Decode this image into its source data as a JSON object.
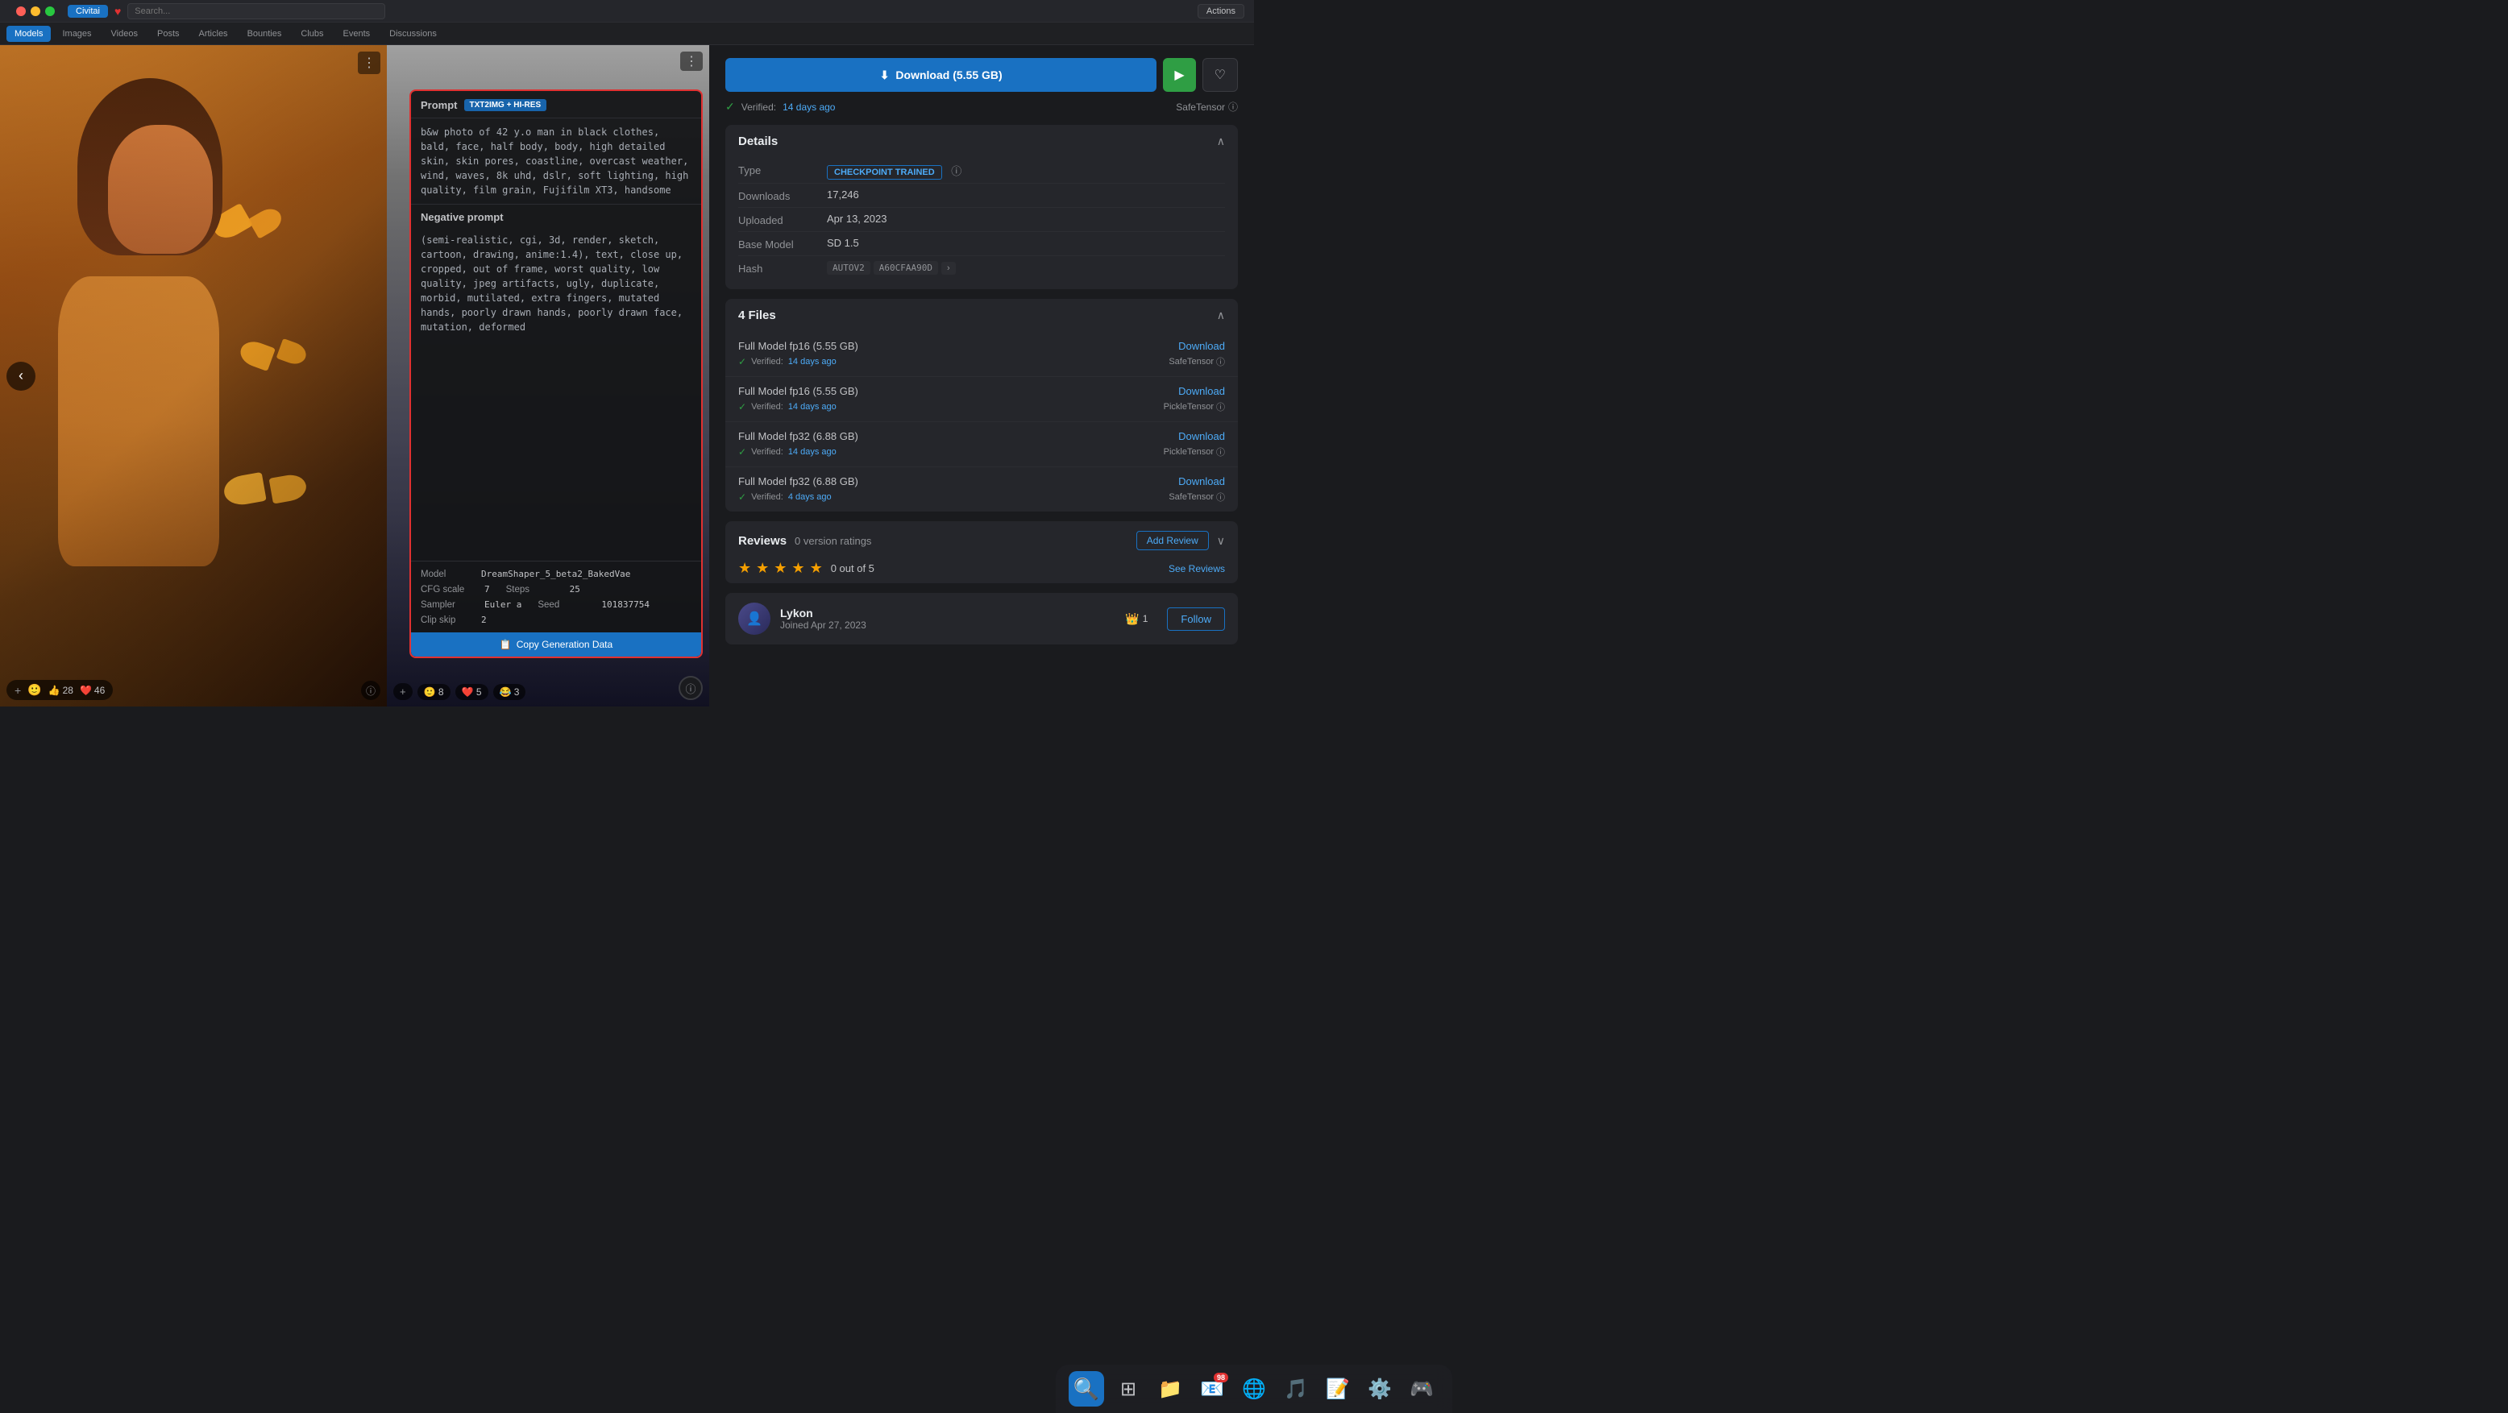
{
  "nav": {
    "btn_label": "Civitai",
    "tabs": [
      "Models",
      "Images",
      "Videos",
      "Posts",
      "Articles",
      "Bounties",
      "Clubs",
      "Events",
      "Discussions"
    ],
    "active_tab": "Models"
  },
  "gallery": {
    "prev_arrow": "‹",
    "next_arrow": "›",
    "reactions": {
      "add": "+",
      "like_count": "28",
      "heart_count": "46"
    },
    "more_btn": "⋮",
    "info_btn": "ⓘ"
  },
  "prompt_overlay": {
    "title": "Prompt",
    "badge": "TXT2IMG + HI-RES",
    "prompt_text": "b&w photo of 42 y.o man in black clothes, bald, face, half body, body, high detailed skin, skin pores, coastline, overcast weather, wind, waves, 8k uhd, dslr, soft lighting, high quality, film grain, Fujifilm XT3, handsome",
    "neg_title": "Negative prompt",
    "neg_text": "(semi-realistic, cgi, 3d, render, sketch, cartoon, drawing, anime:1.4), text, close up, cropped, out of frame, worst quality, low quality, jpeg artifacts, ugly, duplicate, morbid, mutilated, extra fingers, mutated hands, poorly drawn hands, poorly drawn face, mutation, deformed",
    "model_label": "Model",
    "model_value": "DreamShaper_5_beta2_BakedVae",
    "cfg_label": "CFG scale",
    "cfg_value": "7",
    "steps_label": "Steps",
    "steps_value": "25",
    "sampler_label": "Sampler",
    "sampler_value": "Euler a",
    "seed_label": "Seed",
    "seed_value": "101837754",
    "clip_label": "Clip skip",
    "clip_value": "2",
    "copy_btn": "Copy Generation Data"
  },
  "second_image": {
    "more_btn": "⋮",
    "reactions": {
      "add": "+",
      "smiley_count": "8",
      "heart_count": "5",
      "laugh_count": "3"
    },
    "info_btn": "ⓘ"
  },
  "right_panel": {
    "download_btn": "Download (5.55 GB)",
    "verified_text": "Verified:",
    "verified_date": "14 days ago",
    "safe_tensor": "SafeTensor",
    "details_title": "Details",
    "type_label": "Type",
    "type_value": "CHECKPOINT TRAINED",
    "downloads_label": "Downloads",
    "downloads_value": "17,246",
    "uploaded_label": "Uploaded",
    "uploaded_value": "Apr 13, 2023",
    "base_model_label": "Base Model",
    "base_model_value": "SD 1.5",
    "hash_label": "Hash",
    "hash_autov2": "AUTOV2",
    "hash_value": "A60CFAA90D",
    "files_title": "4 Files",
    "files": [
      {
        "name": "Full Model fp16 (5.55 GB)",
        "download": "Download",
        "verified_date": "14 days ago",
        "tensor_type": "SafeTensor"
      },
      {
        "name": "Full Model fp16 (5.55 GB)",
        "download": "Download",
        "verified_date": "14 days ago",
        "tensor_type": "PickleTensor"
      },
      {
        "name": "Full Model fp32 (6.88 GB)",
        "download": "Download",
        "verified_date": "14 days ago",
        "tensor_type": "PickleTensor"
      },
      {
        "name": "Full Model fp32 (6.88 GB)",
        "download": "Download",
        "verified_date": "4 days ago",
        "tensor_type": "SafeTensor"
      }
    ],
    "reviews_title": "Reviews",
    "reviews_count": "0 version ratings",
    "add_review_btn": "Add Review",
    "see_reviews_link": "See Reviews",
    "stars_score": "0 out of 5",
    "creator_name": "Lykon",
    "creator_joined": "Joined Apr 27, 2023",
    "creator_badge_num": "1",
    "follow_btn": "Follow"
  },
  "dock": {
    "items": [
      "🔍",
      "📁",
      "📧",
      "🌐",
      "🎵",
      "📝",
      "⚙️",
      "🎮"
    ],
    "badge_count": "98"
  }
}
